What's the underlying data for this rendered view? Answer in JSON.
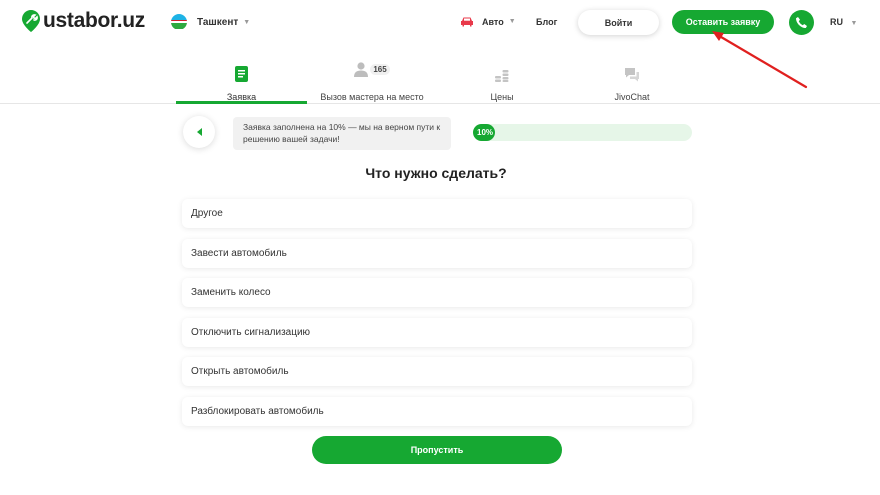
{
  "header": {
    "logo_text": "ustabor.uz",
    "city": "Ташкент",
    "auto_label": "Авто",
    "blog_label": "Блог",
    "login_label": "Войти",
    "order_label": "Оставить заявку",
    "lang": "RU",
    "accent_color": "#16a832"
  },
  "tabs": [
    {
      "label": "Заявка",
      "icon": "document-icon",
      "active": true
    },
    {
      "label": "Вызов мастера на место",
      "icon": "user-icon",
      "badge": "165"
    },
    {
      "label": "Цены",
      "icon": "coins-icon"
    },
    {
      "label": "JivoChat",
      "icon": "chat-icon"
    }
  ],
  "progress": {
    "hint": "Заявка заполнена на 10% — мы на верном пути к решению вашей задачи!",
    "value_label": "10%",
    "value": 0.1
  },
  "question": "Что нужно сделать?",
  "options": [
    "Другое",
    "Завести автомобиль",
    "Заменить колесо",
    "Отключить сигнализацию",
    "Открыть автомобиль",
    "Разблокировать автомобиль"
  ],
  "skip_label": "Пропустить"
}
